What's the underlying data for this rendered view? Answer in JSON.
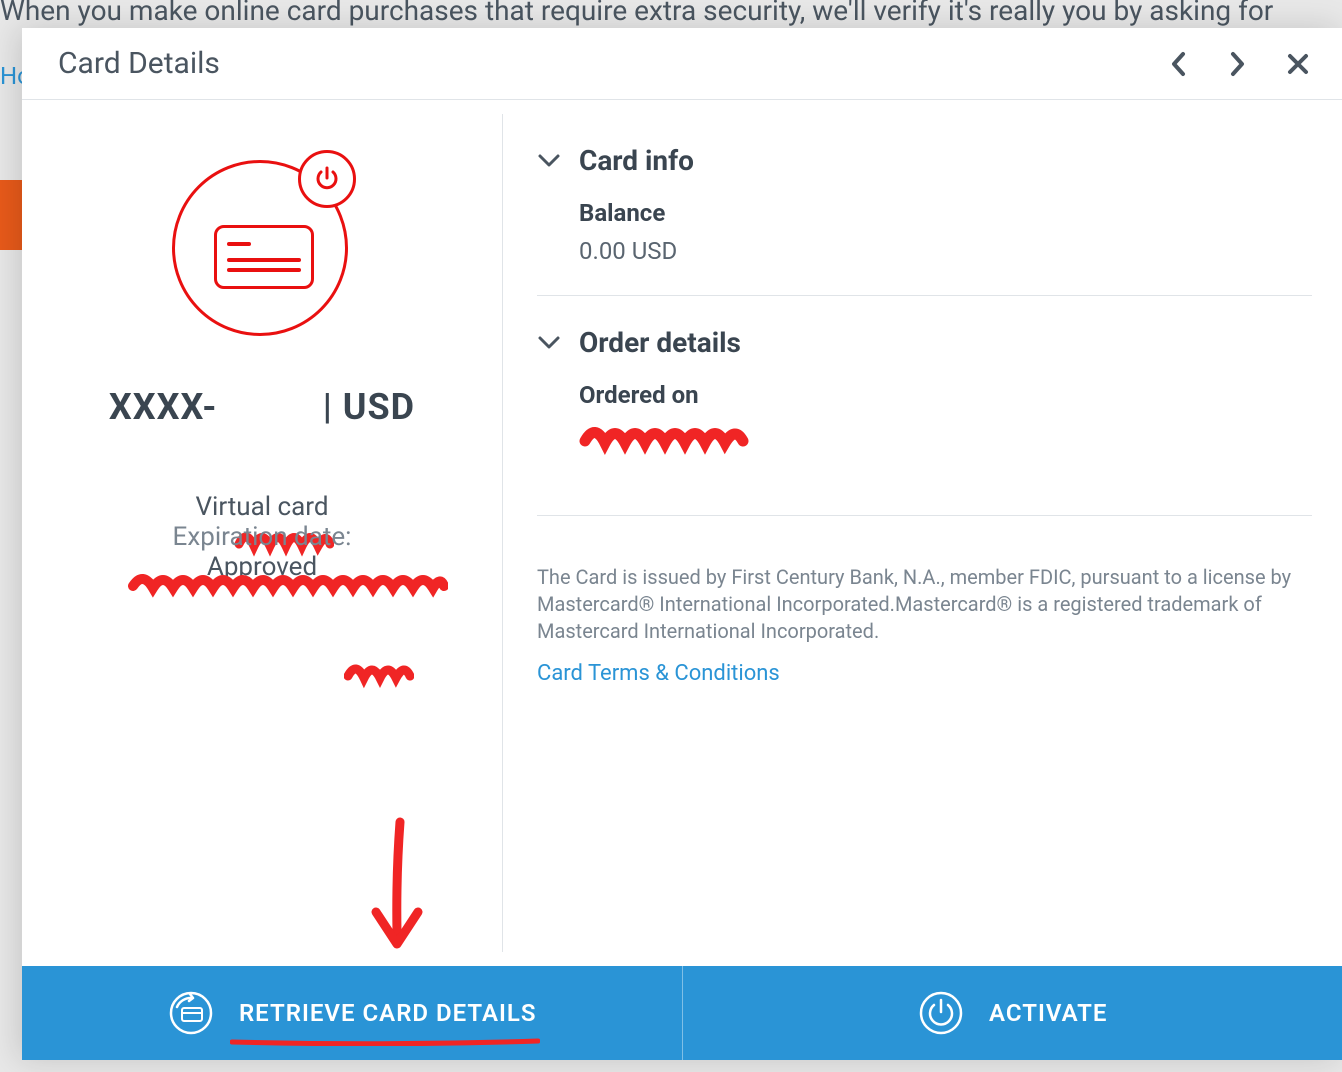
{
  "background": {
    "top_text": "When you make online card purchases that require extra security, we'll verify it's really you by asking for",
    "link_fragment": "Ho"
  },
  "modal": {
    "title": "Card Details"
  },
  "card": {
    "masked": "XXXX-",
    "currency_suffix": " | USD",
    "type": "Virtual card",
    "expiration_label": "Expiration date:",
    "status": "Approved"
  },
  "sections": {
    "card_info": {
      "title": "Card info",
      "balance_label": "Balance",
      "balance_value": "0.00 USD"
    },
    "order_details": {
      "title": "Order details",
      "ordered_on_label": "Ordered on"
    }
  },
  "legal": "The Card is issued by First Century Bank, N.A., member FDIC, pursuant to a license by Mastercard® International Incorporated.Mastercard® is a registered trademark of Mastercard International Incorporated.",
  "terms_link": "Card Terms & Conditions",
  "footer": {
    "retrieve": "RETRIEVE CARD DETAILS",
    "activate": "ACTIVATE"
  }
}
